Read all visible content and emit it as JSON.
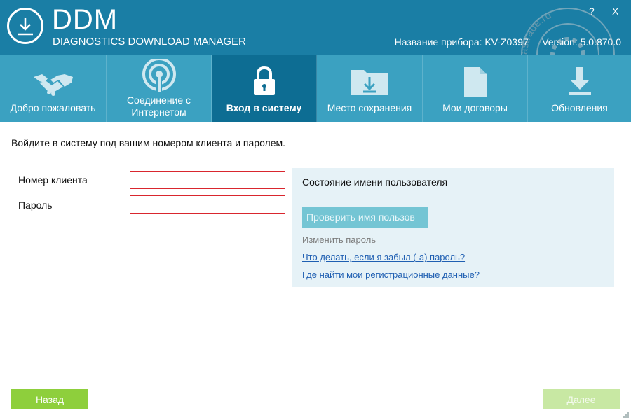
{
  "app": {
    "title": "DDM",
    "subtitle": "DIAGNOSTICS DOWNLOAD MANAGER",
    "device_label": "Название прибора:",
    "device_value": "KV-Z0397",
    "version_label": "Version:",
    "version_value": "5.0.870.0",
    "help_label": "?",
    "close_label": "X",
    "accent": "#1a7ea5"
  },
  "tabs": [
    {
      "label": "Добро пожаловать",
      "icon": "handshake-icon",
      "active": false
    },
    {
      "label": "Соединение с Интернетом",
      "icon": "wifi-signal-icon",
      "active": false
    },
    {
      "label": "Вход в систему",
      "icon": "lock-icon",
      "active": true
    },
    {
      "label": "Место сохранения",
      "icon": "folder-download-icon",
      "active": false
    },
    {
      "label": "Мои договоры",
      "icon": "document-icon",
      "active": false
    },
    {
      "label": "Обновления",
      "icon": "download-update-icon",
      "active": false
    }
  ],
  "login": {
    "instructions": "Войдите в систему под вашим номером клиента и паролем.",
    "client_number_label": "Номер клиента",
    "client_number_value": "",
    "password_label": "Пароль",
    "password_value": ""
  },
  "status": {
    "title": "Состояние имени пользователя",
    "check_button": "Проверить имя пользов",
    "change_password_link": "Изменить пароль",
    "forgot_password_link": "Что делать, если я забыл (-а) пароль?",
    "where_credentials_link": "Где найти мои регистрационные данные?"
  },
  "footer": {
    "back_label": "Назад",
    "next_label": "Далее"
  },
  "watermark": {
    "text": "astrade.ru"
  }
}
